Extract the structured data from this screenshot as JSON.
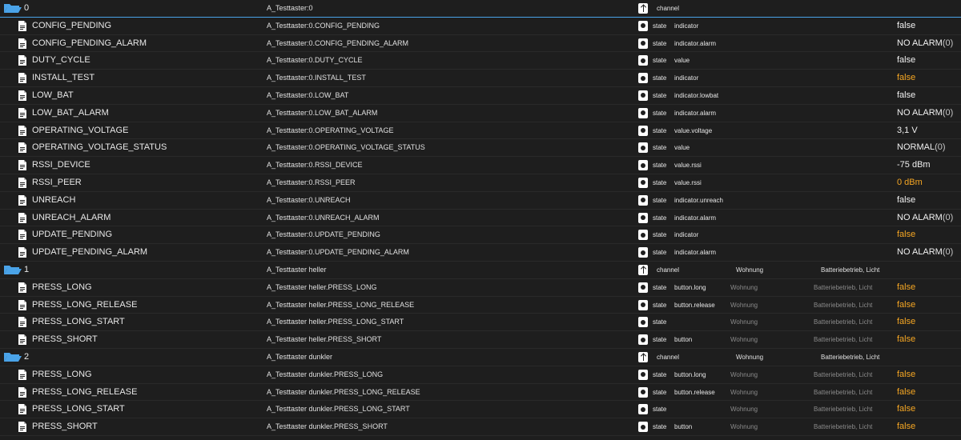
{
  "colors": {
    "selected_row": "#4aa3e8",
    "folder_icon": "#4aa3e8",
    "value_white": "#f0f0f0",
    "value_orange": "#f5a623",
    "background": "#1e1e1e"
  },
  "rows": [
    {
      "kind": "folder",
      "selected": true,
      "name": "0",
      "id": "A_Testtaster:0",
      "type": "channel",
      "role": "",
      "room": "",
      "func": "",
      "value": "",
      "suffix": "",
      "vcolor": "white"
    },
    {
      "kind": "leaf",
      "name": "CONFIG_PENDING",
      "id": "A_Testtaster:0.CONFIG_PENDING",
      "type": "state",
      "role": "indicator",
      "room": "",
      "func": "",
      "value": "false",
      "suffix": "",
      "vcolor": "white"
    },
    {
      "kind": "leaf",
      "name": "CONFIG_PENDING_ALARM",
      "id": "A_Testtaster:0.CONFIG_PENDING_ALARM",
      "type": "state",
      "role": "indicator.alarm",
      "room": "",
      "func": "",
      "value": "NO ALARM",
      "suffix": "(0)",
      "vcolor": "white"
    },
    {
      "kind": "leaf",
      "name": "DUTY_CYCLE",
      "id": "A_Testtaster:0.DUTY_CYCLE",
      "type": "state",
      "role": "value",
      "room": "",
      "func": "",
      "value": "false",
      "suffix": "",
      "vcolor": "white"
    },
    {
      "kind": "leaf",
      "name": "INSTALL_TEST",
      "id": "A_Testtaster:0.INSTALL_TEST",
      "type": "state",
      "role": "indicator",
      "room": "",
      "func": "",
      "value": "false",
      "suffix": "",
      "vcolor": "orange"
    },
    {
      "kind": "leaf",
      "name": "LOW_BAT",
      "id": "A_Testtaster:0.LOW_BAT",
      "type": "state",
      "role": "indicator.lowbat",
      "room": "",
      "func": "",
      "value": "false",
      "suffix": "",
      "vcolor": "white"
    },
    {
      "kind": "leaf",
      "name": "LOW_BAT_ALARM",
      "id": "A_Testtaster:0.LOW_BAT_ALARM",
      "type": "state",
      "role": "indicator.alarm",
      "room": "",
      "func": "",
      "value": "NO ALARM",
      "suffix": "(0)",
      "vcolor": "white"
    },
    {
      "kind": "leaf",
      "name": "OPERATING_VOLTAGE",
      "id": "A_Testtaster:0.OPERATING_VOLTAGE",
      "type": "state",
      "role": "value.voltage",
      "room": "",
      "func": "",
      "value": "3,1 V",
      "suffix": "",
      "vcolor": "white"
    },
    {
      "kind": "leaf",
      "name": "OPERATING_VOLTAGE_STATUS",
      "id": "A_Testtaster:0.OPERATING_VOLTAGE_STATUS",
      "type": "state",
      "role": "value",
      "room": "",
      "func": "",
      "value": "NORMAL",
      "suffix": "(0)",
      "vcolor": "white"
    },
    {
      "kind": "leaf",
      "name": "RSSI_DEVICE",
      "id": "A_Testtaster:0.RSSI_DEVICE",
      "type": "state",
      "role": "value.rssi",
      "room": "",
      "func": "",
      "value": "-75 dBm",
      "suffix": "",
      "vcolor": "white"
    },
    {
      "kind": "leaf",
      "name": "RSSI_PEER",
      "id": "A_Testtaster:0.RSSI_PEER",
      "type": "state",
      "role": "value.rssi",
      "room": "",
      "func": "",
      "value": "0 dBm",
      "suffix": "",
      "vcolor": "orange"
    },
    {
      "kind": "leaf",
      "name": "UNREACH",
      "id": "A_Testtaster:0.UNREACH",
      "type": "state",
      "role": "indicator.unreach",
      "room": "",
      "func": "",
      "value": "false",
      "suffix": "",
      "vcolor": "white"
    },
    {
      "kind": "leaf",
      "name": "UNREACH_ALARM",
      "id": "A_Testtaster:0.UNREACH_ALARM",
      "type": "state",
      "role": "indicator.alarm",
      "room": "",
      "func": "",
      "value": "NO ALARM",
      "suffix": "(0)",
      "vcolor": "white"
    },
    {
      "kind": "leaf",
      "name": "UPDATE_PENDING",
      "id": "A_Testtaster:0.UPDATE_PENDING",
      "type": "state",
      "role": "indicator",
      "room": "",
      "func": "",
      "value": "false",
      "suffix": "",
      "vcolor": "orange"
    },
    {
      "kind": "leaf",
      "name": "UPDATE_PENDING_ALARM",
      "id": "A_Testtaster:0.UPDATE_PENDING_ALARM",
      "type": "state",
      "role": "indicator.alarm",
      "room": "",
      "func": "",
      "value": "NO ALARM",
      "suffix": "(0)",
      "vcolor": "white"
    },
    {
      "kind": "folder",
      "selected": false,
      "name": "1",
      "id": "A_Testtaster heller",
      "type": "channel",
      "role": "",
      "room": "Wohnung",
      "func": "Batteriebetrieb, Licht",
      "value": "",
      "suffix": "",
      "vcolor": "white"
    },
    {
      "kind": "leaf",
      "name": "PRESS_LONG",
      "id": "A_Testtaster heller.PRESS_LONG",
      "type": "state",
      "role": "button.long",
      "room": "Wohnung",
      "func": "Batteriebetrieb, Licht",
      "value": "false",
      "suffix": "",
      "vcolor": "orange"
    },
    {
      "kind": "leaf",
      "name": "PRESS_LONG_RELEASE",
      "id": "A_Testtaster heller.PRESS_LONG_RELEASE",
      "type": "state",
      "role": "button.release",
      "room": "Wohnung",
      "func": "Batteriebetrieb, Licht",
      "value": "false",
      "suffix": "",
      "vcolor": "orange"
    },
    {
      "kind": "leaf",
      "name": "PRESS_LONG_START",
      "id": "A_Testtaster heller.PRESS_LONG_START",
      "type": "state",
      "role": "",
      "room": "Wohnung",
      "func": "Batteriebetrieb, Licht",
      "value": "false",
      "suffix": "",
      "vcolor": "orange"
    },
    {
      "kind": "leaf",
      "name": "PRESS_SHORT",
      "id": "A_Testtaster heller.PRESS_SHORT",
      "type": "state",
      "role": "button",
      "room": "Wohnung",
      "func": "Batteriebetrieb, Licht",
      "value": "false",
      "suffix": "",
      "vcolor": "orange"
    },
    {
      "kind": "folder",
      "selected": false,
      "name": "2",
      "id": "A_Testtaster dunkler",
      "type": "channel",
      "role": "",
      "room": "Wohnung",
      "func": "Batteriebetrieb, Licht",
      "value": "",
      "suffix": "",
      "vcolor": "white"
    },
    {
      "kind": "leaf",
      "name": "PRESS_LONG",
      "id": "A_Testtaster dunkler.PRESS_LONG",
      "type": "state",
      "role": "button.long",
      "room": "Wohnung",
      "func": "Batteriebetrieb, Licht",
      "value": "false",
      "suffix": "",
      "vcolor": "orange"
    },
    {
      "kind": "leaf",
      "name": "PRESS_LONG_RELEASE",
      "id": "A_Testtaster dunkler.PRESS_LONG_RELEASE",
      "type": "state",
      "role": "button.release",
      "room": "Wohnung",
      "func": "Batteriebetrieb, Licht",
      "value": "false",
      "suffix": "",
      "vcolor": "orange"
    },
    {
      "kind": "leaf",
      "name": "PRESS_LONG_START",
      "id": "A_Testtaster dunkler.PRESS_LONG_START",
      "type": "state",
      "role": "",
      "room": "Wohnung",
      "func": "Batteriebetrieb, Licht",
      "value": "false",
      "suffix": "",
      "vcolor": "orange"
    },
    {
      "kind": "leaf",
      "name": "PRESS_SHORT",
      "id": "A_Testtaster dunkler.PRESS_SHORT",
      "type": "state",
      "role": "button",
      "room": "Wohnung",
      "func": "Batteriebetrieb, Licht",
      "value": "false",
      "suffix": "",
      "vcolor": "orange"
    }
  ]
}
